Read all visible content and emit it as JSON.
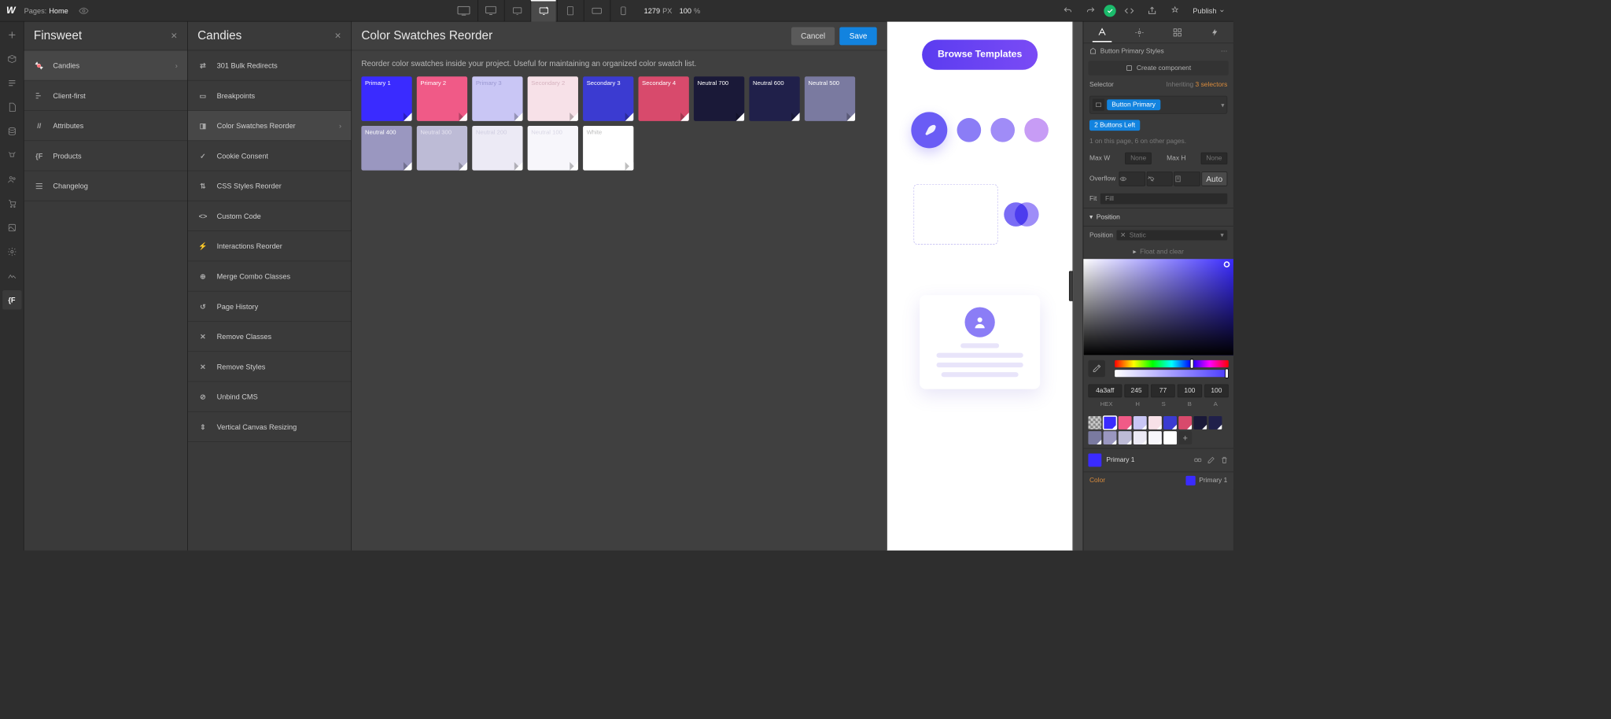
{
  "topbar": {
    "pagesLabel": "Pages:",
    "pageName": "Home",
    "widthPx": "1279",
    "pxLabel": "PX",
    "zoom": "100",
    "zoomUnit": "%",
    "publish": "Publish"
  },
  "panel1": {
    "title": "Finsweet",
    "items": [
      {
        "label": "Candies",
        "hasSub": true,
        "selected": true
      },
      {
        "label": "Client-first"
      },
      {
        "label": "Attributes"
      },
      {
        "label": "Products"
      },
      {
        "label": "Changelog"
      }
    ]
  },
  "panel2": {
    "title": "Candies",
    "items": [
      {
        "label": "301 Bulk Redirects"
      },
      {
        "label": "Breakpoints"
      },
      {
        "label": "Color Swatches Reorder",
        "hasSub": true,
        "selected": true
      },
      {
        "label": "Cookie Consent"
      },
      {
        "label": "CSS Styles Reorder"
      },
      {
        "label": "Custom Code"
      },
      {
        "label": "Interactions Reorder"
      },
      {
        "label": "Merge Combo Classes"
      },
      {
        "label": "Page History"
      },
      {
        "label": "Remove Classes"
      },
      {
        "label": "Remove Styles"
      },
      {
        "label": "Unbind CMS"
      },
      {
        "label": "Vertical Canvas Resizing"
      }
    ]
  },
  "content": {
    "title": "Color Swatches Reorder",
    "cancel": "Cancel",
    "save": "Save",
    "desc": "Reorder color swatches inside your project. Useful for maintaining an organized color swatch list.",
    "swatches": [
      {
        "name": "Primary 1",
        "bg": "#3a2bff",
        "fg": "#fff"
      },
      {
        "name": "Primary 2",
        "bg": "#f05a87",
        "fg": "#fff"
      },
      {
        "name": "Primary 3",
        "bg": "#c9c6f5",
        "fg": "#9a97d0"
      },
      {
        "name": "Secondary 2",
        "bg": "#f7e1e8",
        "fg": "#d6b3bf"
      },
      {
        "name": "Secondary 3",
        "bg": "#3b3bd1",
        "fg": "#fff"
      },
      {
        "name": "Secondary 4",
        "bg": "#d84a6c",
        "fg": "#fff"
      },
      {
        "name": "Neutral 700",
        "bg": "#1a1938",
        "fg": "#fff"
      },
      {
        "name": "Neutral 600",
        "bg": "#20204a",
        "fg": "#fff"
      },
      {
        "name": "Neutral 500",
        "bg": "#7a7aa0",
        "fg": "#fff"
      },
      {
        "name": "Neutral 400",
        "bg": "#9a97c0",
        "fg": "#fff"
      },
      {
        "name": "Neutral 300",
        "bg": "#bdbbd6",
        "fg": "#e8e6f2"
      },
      {
        "name": "Neutral 200",
        "bg": "#eceaf5",
        "fg": "#cfcde0"
      },
      {
        "name": "Neutral 100",
        "bg": "#f7f6fb",
        "fg": "#d8d6e4"
      },
      {
        "name": "White",
        "bg": "#ffffff",
        "fg": "#bdbdbd"
      }
    ]
  },
  "canvas": {
    "browse": "Browse Templates"
  },
  "inspector": {
    "styleTitle": "Button Primary Styles",
    "createComp": "Create component",
    "selectorLabel": "Selector",
    "inheriting": "Inheriting",
    "inheritCount": "3 selectors",
    "class": "Button Primary",
    "combo": "2 Buttons Left",
    "usage1": "1 on this page, 6 on other pages.",
    "maxW": "Max W",
    "maxH": "Max H",
    "none": "None",
    "overflow": "Overflow",
    "auto": "Auto",
    "fit": "Fit",
    "fill": "Fill",
    "position": "Position",
    "posSection": "Position",
    "static": "Static",
    "float": "Float and clear",
    "hex": "4a3aff",
    "h": "245",
    "s": "77",
    "b": "100",
    "a": "100",
    "hexL": "HEX",
    "hL": "H",
    "sL": "S",
    "bL": "B",
    "aL": "A",
    "currentSwatch": "Primary 1",
    "colorLabel": "Color",
    "colorName": "Primary 1",
    "miniSwatches": [
      "#3a2bff",
      "#f05a87",
      "#c9c6f5",
      "#f7e1e8",
      "#3b3bd1",
      "#d84a6c",
      "#1a1938",
      "#20204a",
      "#7a7aa0",
      "#9a97c0",
      "#bdbbd6",
      "#eceaf5",
      "#f7f6fb",
      "#ffffff"
    ]
  }
}
